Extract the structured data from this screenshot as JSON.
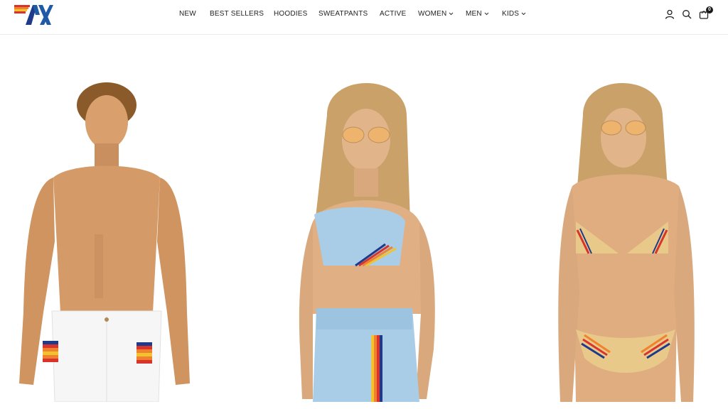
{
  "brand": {
    "name": "Aviator Nation",
    "logo_text": "AV"
  },
  "nav": {
    "items": [
      {
        "label": "NEW",
        "has_dropdown": false
      },
      {
        "label": "BEST SELLERS",
        "has_dropdown": false
      },
      {
        "label": "HOODIES",
        "has_dropdown": false
      },
      {
        "label": "SWEATPANTS",
        "has_dropdown": false
      },
      {
        "label": "ACTIVE",
        "has_dropdown": false
      },
      {
        "label": "WOMEN",
        "has_dropdown": true
      },
      {
        "label": "MEN",
        "has_dropdown": true
      },
      {
        "label": "KIDS",
        "has_dropdown": true
      }
    ]
  },
  "header_icons": {
    "account": "account-icon",
    "search": "search-icon",
    "cart": "cart-icon",
    "cart_count": "0"
  },
  "colors": {
    "stripe_red": "#d9342b",
    "stripe_orange": "#f0822d",
    "stripe_yellow": "#f2c230",
    "stripe_navy": "#1f3a8a",
    "logo_blue": "#1f5aa6",
    "light_blue": "#a9cde6",
    "sand": "#e9c98a"
  },
  "products": [
    {
      "name": "men-shorts-model"
    },
    {
      "name": "women-active-set-model"
    },
    {
      "name": "women-bikini-model"
    }
  ]
}
